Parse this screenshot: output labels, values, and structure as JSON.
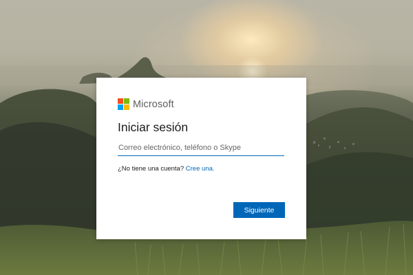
{
  "login": {
    "brand_name": "Microsoft",
    "title": "Iniciar sesión",
    "email_placeholder": "Correo electrónico, teléfono o Skype",
    "email_value": "",
    "no_account_text": "¿No tiene una cuenta?",
    "create_link": "Cree una.",
    "next_button": "Siguiente"
  },
  "logo_colors": {
    "red": "#f25022",
    "green": "#7fba00",
    "blue": "#00a4ef",
    "yellow": "#ffb900"
  },
  "accent_color": "#0067b8",
  "background": {
    "icon": "mountain-sunset-landscape"
  }
}
